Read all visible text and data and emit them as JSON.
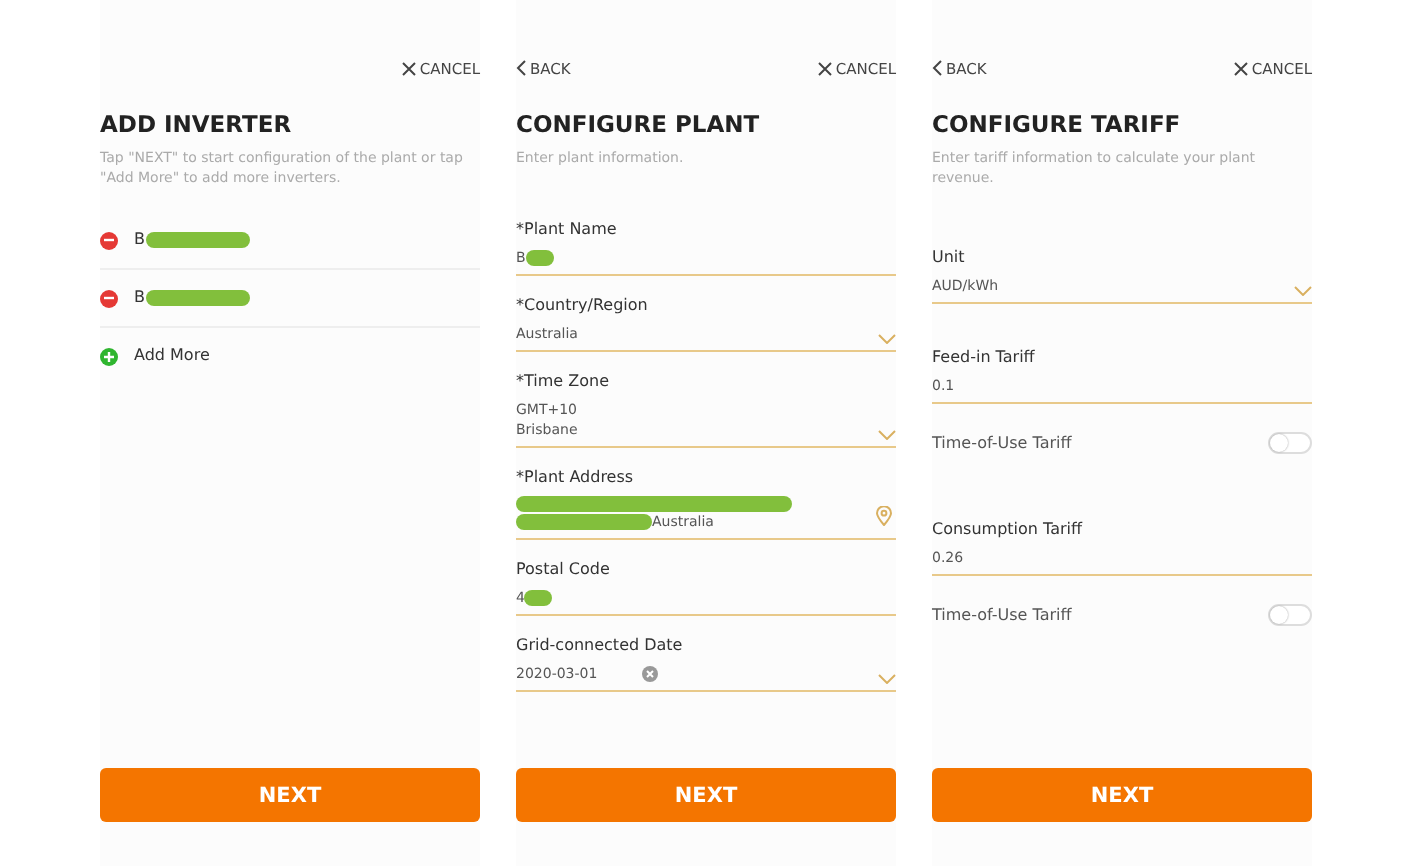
{
  "panels": [
    {
      "cancel": "CANCEL",
      "title": "ADD INVERTER",
      "subtitle": "Tap \"NEXT\" to start configuration of the plant or tap \"Add More\" to add more inverters.",
      "items": [
        {
          "kind": "remove",
          "text": "B",
          "redacted": true
        },
        {
          "kind": "remove",
          "text": "B",
          "redacted": true
        },
        {
          "kind": "add",
          "text": "Add More",
          "redacted": false
        }
      ],
      "button": "NEXT"
    },
    {
      "back": "BACK",
      "cancel": "CANCEL",
      "title": "CONFIGURE PLANT",
      "subtitle": "Enter plant information.",
      "fields": [
        {
          "kind": "text",
          "label": "*Plant Name",
          "lines": [
            "B"
          ],
          "redacted": true
        },
        {
          "kind": "select",
          "label": "*Country/Region",
          "lines": [
            "Australia"
          ],
          "redacted": false
        },
        {
          "kind": "select",
          "label": "*Time Zone",
          "lines": [
            "GMT+10",
            "Brisbane"
          ],
          "redacted": false
        },
        {
          "kind": "location",
          "label": "*Plant Address",
          "lines": [
            "Australia"
          ],
          "redacted": true
        },
        {
          "kind": "text",
          "label": "Postal Code",
          "lines": [
            "4"
          ],
          "redacted": true
        },
        {
          "kind": "date",
          "label": "Grid-connected Date",
          "lines": [
            "2020-03-01"
          ],
          "redacted": false
        }
      ],
      "button": "NEXT"
    },
    {
      "back": "BACK",
      "cancel": "CANCEL",
      "title": "CONFIGURE TARIFF",
      "subtitle": "Enter tariff information to calculate your plant revenue.",
      "fields": [
        {
          "kind": "select",
          "label": "Unit",
          "lines": [
            "AUD/kWh"
          ],
          "redacted": false
        },
        {
          "kind": "text",
          "label": "Feed-in Tariff",
          "lines": [
            "0.1"
          ],
          "redacted": false
        },
        {
          "kind": "toggle",
          "label": "Time-of-Use Tariff",
          "on": false
        },
        {
          "kind": "text",
          "label": "Consumption Tariff",
          "lines": [
            "0.26"
          ],
          "redacted": false
        },
        {
          "kind": "toggle",
          "label": "Time-of-Use Tariff",
          "on": false
        }
      ],
      "button": "NEXT"
    }
  ]
}
